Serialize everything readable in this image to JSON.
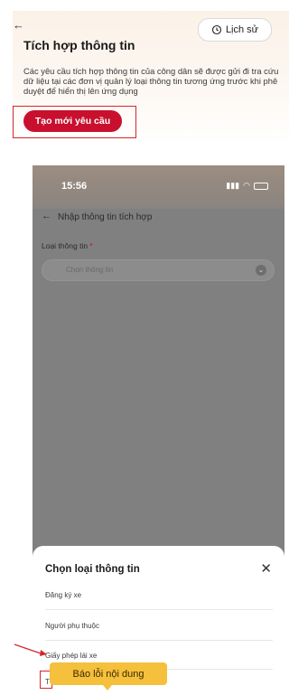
{
  "top": {
    "back_glyph": "←",
    "history_label": "Lịch sử",
    "title": "Tích hợp thông tin",
    "description": "Các yêu cầu tích hợp thông tin của công dân sẽ được gửi đi tra cứu dữ liệu tại các đơn vị quản lý loại thông tin tương ứng trước khi phê duyệt để hiển thị lên ứng dụng",
    "create_label": "Tạo mới yêu cầu"
  },
  "phone": {
    "time": "15:56",
    "back_glyph": "←",
    "title": "Nhập thông tin tích hợp",
    "field_label": "Loại thông tin",
    "required_mark": "*",
    "select_placeholder": "Chọn thông tin"
  },
  "sheet": {
    "title": "Chọn loại thông tin",
    "close_glyph": "✕",
    "options": [
      "Đăng ký xe",
      "Người phụ thuộc",
      "Giấy phép lái xe",
      "T"
    ]
  },
  "tooltip": {
    "label": "Báo lỗi nội dung"
  },
  "colors": {
    "brand_red": "#c8102e",
    "tooltip_yellow": "#f5c03b"
  }
}
